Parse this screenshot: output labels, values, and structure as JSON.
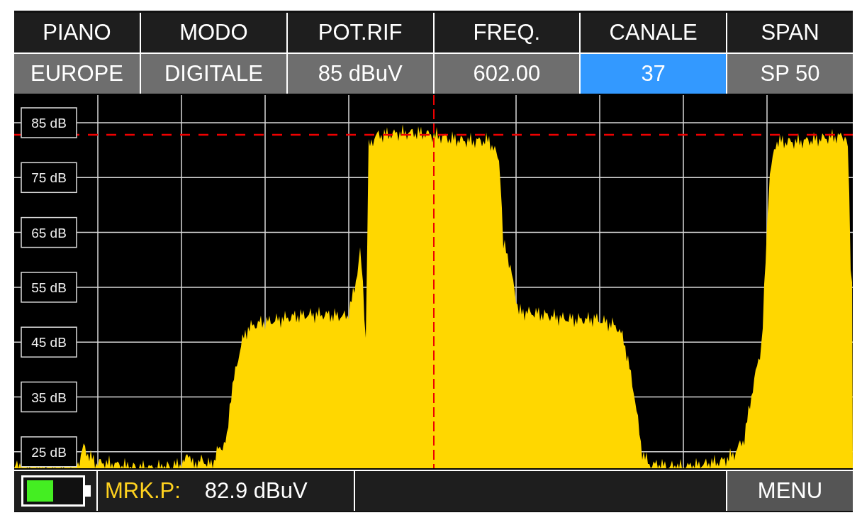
{
  "parameters": [
    {
      "title": "PIANO",
      "value": "EUROPE",
      "selected": false
    },
    {
      "title": "MODO",
      "value": "DIGITALE",
      "selected": false
    },
    {
      "title": "POT.RIF",
      "value": "85 dBuV",
      "selected": false
    },
    {
      "title": "FREQ.",
      "value": "602.00",
      "selected": false
    },
    {
      "title": "CANALE",
      "value": "37",
      "selected": true
    },
    {
      "title": "SPAN",
      "value": "SP 50",
      "selected": false
    }
  ],
  "spectrum": {
    "y_axis_labels": [
      "85 dB",
      "75 dB",
      "65 dB",
      "55 dB",
      "45 dB",
      "35 dB",
      "25 dB"
    ]
  },
  "status_bar": {
    "marker_label": "MRK.P:",
    "marker_value": "82.9 dBuV",
    "menu": "MENU"
  }
}
